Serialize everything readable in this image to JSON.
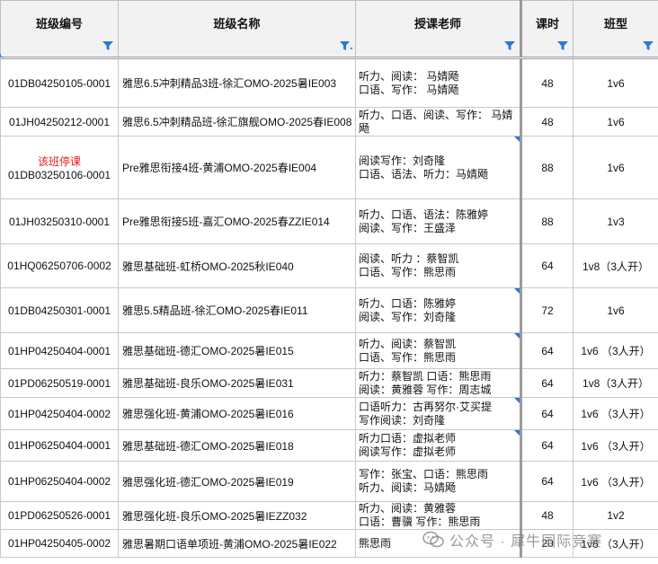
{
  "headers": {
    "code": "班级编号",
    "name": "班级名称",
    "teacher": "授课老师",
    "hours": "课时",
    "type": "班型"
  },
  "rows": [
    {
      "code": "01DB04250105-0001",
      "note": "",
      "name": "雅思6.5冲刺精品3班-徐汇OMO-2025暑IE003",
      "teacher": [
        "听力、阅读： 马婧飏",
        "口语、写作： 马婧飏"
      ],
      "hours": "48",
      "type": "1v6",
      "flag": false
    },
    {
      "code": "01JH04250212-0001",
      "note": "",
      "name": "雅思6.5冲刺精品班-徐汇旗舰OMO-2025春IE008",
      "teacher": [
        "听力、口语、阅读、写作： 马婧飏"
      ],
      "hours": "48",
      "type": "1v6",
      "flag": false
    },
    {
      "code": "01DB03250106-0001",
      "note": "该班停课",
      "name": "Pre雅思衔接4班-黄浦OMO-2025春IE004",
      "teacher": [
        "阅读写作：刘奇隆",
        "口语、语法、听力：马婧飏"
      ],
      "hours": "88",
      "type": "1v6",
      "flag": true
    },
    {
      "code": "01JH03250310-0001",
      "note": "",
      "name": "Pre雅思衔接5班-嘉汇OMO-2025春ZZIE014",
      "teacher": [
        "听力、口语、语法：陈雅婷",
        "阅读、写作：王盛泽"
      ],
      "hours": "88",
      "type": "1v3",
      "flag": false
    },
    {
      "code": "01HQ06250706-0002",
      "note": "",
      "name": "雅思基础班-虹桥OMO-2025秋IE040",
      "teacher": [
        "阅读、听力 ：蔡智凯",
        "口语、写作：熊思雨"
      ],
      "hours": "64",
      "type": "1v8（3人开）",
      "flag": false
    },
    {
      "code": "01DB04250301-0001",
      "note": "",
      "name": "雅思5.5精品班-徐汇OMO-2025春IE011",
      "teacher": [
        "听力、口语：陈雅婷",
        "阅读、写作：刘奇隆"
      ],
      "hours": "72",
      "type": "1v6",
      "flag": true
    },
    {
      "code": "01HP04250404-0001",
      "note": "",
      "name": "雅思基础班-德汇OMO-2025暑IE015",
      "teacher": [
        "听力、阅读：蔡智凯",
        "口语、写作：熊思雨"
      ],
      "hours": "64",
      "type": "1v6 （3人开）",
      "flag": true
    },
    {
      "code": "01PD06250519-0001",
      "note": "",
      "name": "雅思基础班-良乐OMO-2025暑IE031",
      "teacher": [
        "听力：蔡智凯  口语：熊思雨",
        "阅读：黄雅蓉  写作：周志城"
      ],
      "hours": "64",
      "type": "1v8（3人开）",
      "flag": false
    },
    {
      "code": "01HP04250404-0002",
      "note": "",
      "name": "雅思强化班-黄浦OMO-2025暑IE016",
      "teacher": [
        "口语听力：古再努尔·艾买提",
        "写作阅读：刘奇隆"
      ],
      "hours": "64",
      "type": "1v6 （3人开）",
      "flag": true
    },
    {
      "code": "01HP06250404-0001",
      "note": "",
      "name": "雅思基础班-德汇OMO-2025暑IE018",
      "teacher": [
        "听力口语：虚拟老师",
        "阅读写作：虚拟老师"
      ],
      "hours": "64",
      "type": "1v6 （3人开）",
      "flag": true
    },
    {
      "code": "01HP06250404-0002",
      "note": "",
      "name": "雅思强化班-德汇OMO-2025暑IE019",
      "teacher": [
        "写作：张宝、口语：熊思雨",
        "听力、阅读：马婧飏"
      ],
      "hours": "64",
      "type": "1v6 （3人开）",
      "flag": false
    },
    {
      "code": "01PD06250526-0001",
      "note": "",
      "name": "雅思强化班-良乐OMO-2025暑IEZZ032",
      "teacher": [
        "听力、阅读：黄雅蓉",
        "口语：曹骥   写作：熊思雨"
      ],
      "hours": "48",
      "type": "1v2",
      "flag": false
    },
    {
      "code": "01HP04250405-0002",
      "note": "",
      "name": "雅思暑期口语单项班-黄浦OMO-2025暑IE022",
      "teacher": [
        "熊思雨"
      ],
      "hours": "20",
      "type": "1v6 （3人开）",
      "flag": false
    }
  ],
  "watermark": {
    "text": "公众号 · 犀牛国际竞赛",
    "icon": "wechat-icon"
  },
  "colors": {
    "header_bg": "#f2f2f2",
    "filter_icon": "#2a78d6",
    "paused_text": "#e02020"
  }
}
